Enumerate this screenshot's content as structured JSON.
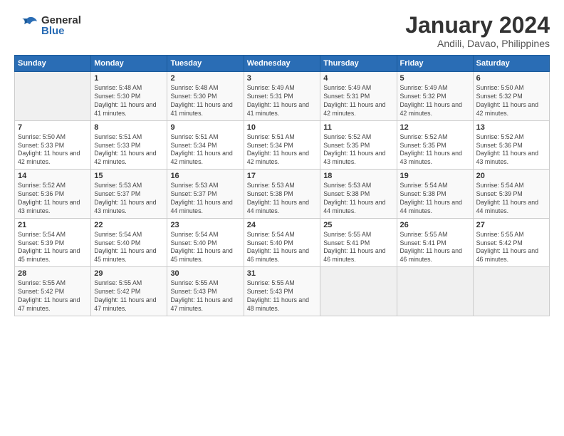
{
  "logo": {
    "general": "General",
    "blue": "Blue"
  },
  "title": "January 2024",
  "subtitle": "Andili, Davao, Philippines",
  "days_of_week": [
    "Sunday",
    "Monday",
    "Tuesday",
    "Wednesday",
    "Thursday",
    "Friday",
    "Saturday"
  ],
  "weeks": [
    [
      {
        "day": "",
        "sunrise": "",
        "sunset": "",
        "daylight": ""
      },
      {
        "day": "1",
        "sunrise": "Sunrise: 5:48 AM",
        "sunset": "Sunset: 5:30 PM",
        "daylight": "Daylight: 11 hours and 41 minutes."
      },
      {
        "day": "2",
        "sunrise": "Sunrise: 5:48 AM",
        "sunset": "Sunset: 5:30 PM",
        "daylight": "Daylight: 11 hours and 41 minutes."
      },
      {
        "day": "3",
        "sunrise": "Sunrise: 5:49 AM",
        "sunset": "Sunset: 5:31 PM",
        "daylight": "Daylight: 11 hours and 41 minutes."
      },
      {
        "day": "4",
        "sunrise": "Sunrise: 5:49 AM",
        "sunset": "Sunset: 5:31 PM",
        "daylight": "Daylight: 11 hours and 42 minutes."
      },
      {
        "day": "5",
        "sunrise": "Sunrise: 5:49 AM",
        "sunset": "Sunset: 5:32 PM",
        "daylight": "Daylight: 11 hours and 42 minutes."
      },
      {
        "day": "6",
        "sunrise": "Sunrise: 5:50 AM",
        "sunset": "Sunset: 5:32 PM",
        "daylight": "Daylight: 11 hours and 42 minutes."
      }
    ],
    [
      {
        "day": "7",
        "sunrise": "Sunrise: 5:50 AM",
        "sunset": "Sunset: 5:33 PM",
        "daylight": "Daylight: 11 hours and 42 minutes."
      },
      {
        "day": "8",
        "sunrise": "Sunrise: 5:51 AM",
        "sunset": "Sunset: 5:33 PM",
        "daylight": "Daylight: 11 hours and 42 minutes."
      },
      {
        "day": "9",
        "sunrise": "Sunrise: 5:51 AM",
        "sunset": "Sunset: 5:34 PM",
        "daylight": "Daylight: 11 hours and 42 minutes."
      },
      {
        "day": "10",
        "sunrise": "Sunrise: 5:51 AM",
        "sunset": "Sunset: 5:34 PM",
        "daylight": "Daylight: 11 hours and 42 minutes."
      },
      {
        "day": "11",
        "sunrise": "Sunrise: 5:52 AM",
        "sunset": "Sunset: 5:35 PM",
        "daylight": "Daylight: 11 hours and 43 minutes."
      },
      {
        "day": "12",
        "sunrise": "Sunrise: 5:52 AM",
        "sunset": "Sunset: 5:35 PM",
        "daylight": "Daylight: 11 hours and 43 minutes."
      },
      {
        "day": "13",
        "sunrise": "Sunrise: 5:52 AM",
        "sunset": "Sunset: 5:36 PM",
        "daylight": "Daylight: 11 hours and 43 minutes."
      }
    ],
    [
      {
        "day": "14",
        "sunrise": "Sunrise: 5:52 AM",
        "sunset": "Sunset: 5:36 PM",
        "daylight": "Daylight: 11 hours and 43 minutes."
      },
      {
        "day": "15",
        "sunrise": "Sunrise: 5:53 AM",
        "sunset": "Sunset: 5:37 PM",
        "daylight": "Daylight: 11 hours and 43 minutes."
      },
      {
        "day": "16",
        "sunrise": "Sunrise: 5:53 AM",
        "sunset": "Sunset: 5:37 PM",
        "daylight": "Daylight: 11 hours and 44 minutes."
      },
      {
        "day": "17",
        "sunrise": "Sunrise: 5:53 AM",
        "sunset": "Sunset: 5:38 PM",
        "daylight": "Daylight: 11 hours and 44 minutes."
      },
      {
        "day": "18",
        "sunrise": "Sunrise: 5:53 AM",
        "sunset": "Sunset: 5:38 PM",
        "daylight": "Daylight: 11 hours and 44 minutes."
      },
      {
        "day": "19",
        "sunrise": "Sunrise: 5:54 AM",
        "sunset": "Sunset: 5:38 PM",
        "daylight": "Daylight: 11 hours and 44 minutes."
      },
      {
        "day": "20",
        "sunrise": "Sunrise: 5:54 AM",
        "sunset": "Sunset: 5:39 PM",
        "daylight": "Daylight: 11 hours and 44 minutes."
      }
    ],
    [
      {
        "day": "21",
        "sunrise": "Sunrise: 5:54 AM",
        "sunset": "Sunset: 5:39 PM",
        "daylight": "Daylight: 11 hours and 45 minutes."
      },
      {
        "day": "22",
        "sunrise": "Sunrise: 5:54 AM",
        "sunset": "Sunset: 5:40 PM",
        "daylight": "Daylight: 11 hours and 45 minutes."
      },
      {
        "day": "23",
        "sunrise": "Sunrise: 5:54 AM",
        "sunset": "Sunset: 5:40 PM",
        "daylight": "Daylight: 11 hours and 45 minutes."
      },
      {
        "day": "24",
        "sunrise": "Sunrise: 5:54 AM",
        "sunset": "Sunset: 5:40 PM",
        "daylight": "Daylight: 11 hours and 46 minutes."
      },
      {
        "day": "25",
        "sunrise": "Sunrise: 5:55 AM",
        "sunset": "Sunset: 5:41 PM",
        "daylight": "Daylight: 11 hours and 46 minutes."
      },
      {
        "day": "26",
        "sunrise": "Sunrise: 5:55 AM",
        "sunset": "Sunset: 5:41 PM",
        "daylight": "Daylight: 11 hours and 46 minutes."
      },
      {
        "day": "27",
        "sunrise": "Sunrise: 5:55 AM",
        "sunset": "Sunset: 5:42 PM",
        "daylight": "Daylight: 11 hours and 46 minutes."
      }
    ],
    [
      {
        "day": "28",
        "sunrise": "Sunrise: 5:55 AM",
        "sunset": "Sunset: 5:42 PM",
        "daylight": "Daylight: 11 hours and 47 minutes."
      },
      {
        "day": "29",
        "sunrise": "Sunrise: 5:55 AM",
        "sunset": "Sunset: 5:42 PM",
        "daylight": "Daylight: 11 hours and 47 minutes."
      },
      {
        "day": "30",
        "sunrise": "Sunrise: 5:55 AM",
        "sunset": "Sunset: 5:43 PM",
        "daylight": "Daylight: 11 hours and 47 minutes."
      },
      {
        "day": "31",
        "sunrise": "Sunrise: 5:55 AM",
        "sunset": "Sunset: 5:43 PM",
        "daylight": "Daylight: 11 hours and 48 minutes."
      },
      {
        "day": "",
        "sunrise": "",
        "sunset": "",
        "daylight": ""
      },
      {
        "day": "",
        "sunrise": "",
        "sunset": "",
        "daylight": ""
      },
      {
        "day": "",
        "sunrise": "",
        "sunset": "",
        "daylight": ""
      }
    ]
  ]
}
